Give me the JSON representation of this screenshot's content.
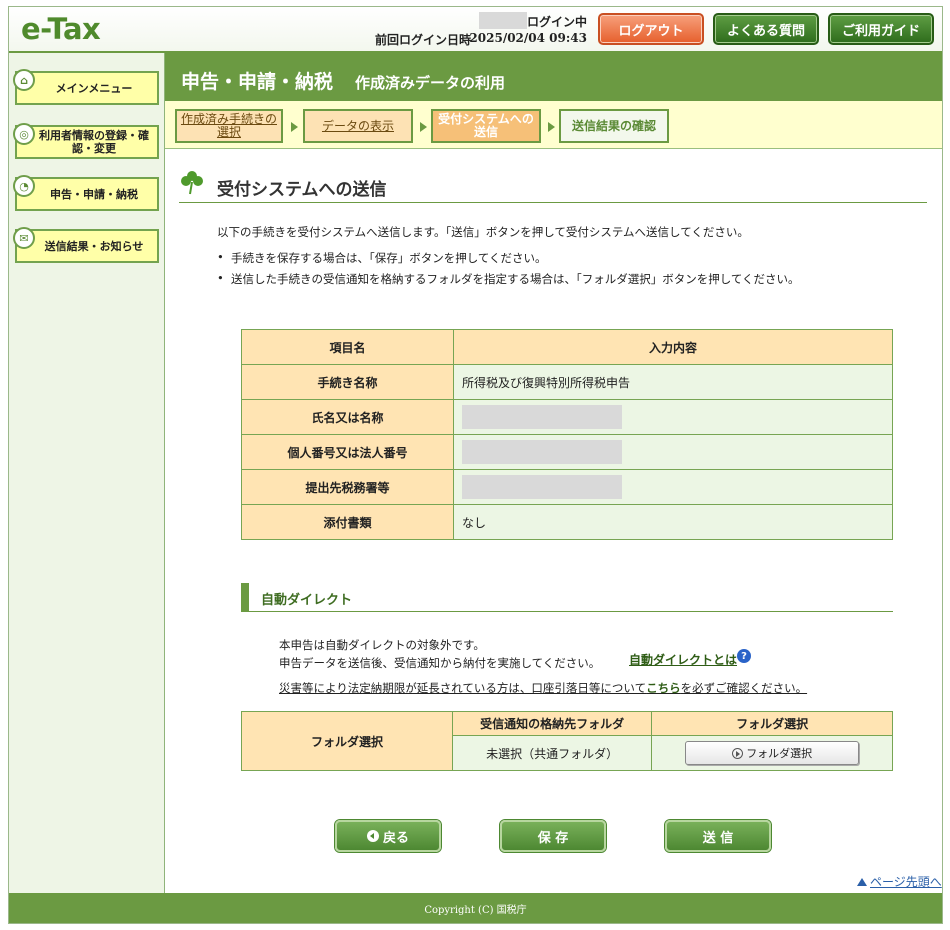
{
  "header": {
    "logo": "e-Tax",
    "login_status": "ログイン中",
    "last_login_label": "前回ログイン日時",
    "last_login_value": "2025/02/04 09:43",
    "logout_label": "ログアウト",
    "faq_label": "よくある質問",
    "guide_label": "ご利用ガイド"
  },
  "sidebar": {
    "items": [
      {
        "label": "メインメニュー",
        "icon": "home-icon"
      },
      {
        "label": "利用者情報の登録・確認・変更",
        "icon": "user-settings-icon"
      },
      {
        "label": "申告・申請・納税",
        "icon": "clock-icon"
      },
      {
        "label": "送信結果・お知らせ",
        "icon": "mail-icon"
      }
    ]
  },
  "title": {
    "main": "申告・申請・納税",
    "sub": "作成済みデータの利用"
  },
  "steps": [
    {
      "label": "作成済み手続きの選択",
      "state": "link"
    },
    {
      "label": "データの表示",
      "state": "link"
    },
    {
      "label": "受付システムへの送信",
      "state": "current"
    },
    {
      "label": "送信結果の確認",
      "state": "future"
    }
  ],
  "section_title": "受付システムへの送信",
  "intro": "以下の手続きを受付システムへ送信します。「送信」ボタンを押して受付システムへ送信してください。",
  "bullets": [
    "手続きを保存する場合は、「保存」ボタンを押してください。",
    "送信した手続きの受信通知を格納するフォルダを指定する場合は、「フォルダ選択」ボタンを押してください。"
  ],
  "info_table": {
    "headers": [
      "項目名",
      "入力内容"
    ],
    "rows": [
      {
        "label": "手続き名称",
        "value": "所得税及び復興特別所得税申告",
        "masked": false
      },
      {
        "label": "氏名又は名称",
        "value": "",
        "masked": true
      },
      {
        "label": "個人番号又は法人番号",
        "value": "",
        "masked": true
      },
      {
        "label": "提出先税務署等",
        "value": "",
        "masked": true
      },
      {
        "label": "添付書類",
        "value": "なし",
        "masked": false
      }
    ]
  },
  "auto_direct": {
    "title": "自動ダイレクト",
    "line1": "本申告は自動ダイレクトの対象外です。",
    "line2": "申告データを送信後、受信通知から納付を実施してください。",
    "link": "自動ダイレクトとは",
    "disaster_pre": "災害等により法定納期限が延長されている方は、口座引落日等について",
    "disaster_link": "こちら",
    "disaster_post": "を必ずご確認ください。"
  },
  "folder_table": {
    "row_header": "フォルダ選択",
    "col_headers": [
      "受信通知の格納先フォルダ",
      "フォルダ選択"
    ],
    "current_folder": "未選択（共通フォルダ）",
    "button_label": "フォルダ選択"
  },
  "actions": {
    "back": "戻る",
    "save": "保 存",
    "send": "送 信"
  },
  "page_top": "ページ先頭へ",
  "footer": "Copyright (C) 国税庁",
  "colors": {
    "brand_green": "#6b9a42",
    "logout_orange": "#e65f2c",
    "header_cell": "#ffe4b3",
    "value_cell": "#ecf6e4"
  }
}
